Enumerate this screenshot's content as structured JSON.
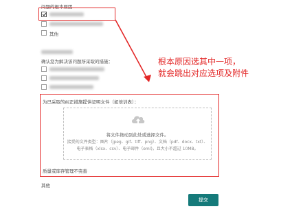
{
  "section1": {
    "title": "问题的根本原因",
    "options": [
      {
        "label": "",
        "checked": true
      },
      {
        "label": "",
        "checked": false
      },
      {
        "label": "其他",
        "checked": false
      }
    ]
  },
  "section2": {
    "title": "确认您为解决该问题所采取的措施："
  },
  "annotation": {
    "line1": "根本原因选其中一项，",
    "line2": "就会跳出对应选项及附件"
  },
  "upload": {
    "title": "为已采取的纠正措施提供证明文件（如培训表）：",
    "icon": "cloud-upload-icon",
    "main_text": "将文件拖动到此处或选择文件。",
    "types_line1": "接受的文件类型：图片（jpeg、gif、tiff、png）、文档（pdf、docx、txt）、",
    "types_line2": "电子表格（xlsx、csv）、电子邮件（eml)，且大小不超过 10MB。"
  },
  "next_item": "质量或库存管理不完善",
  "other_label": "其他",
  "submit_label": "提交",
  "colors": {
    "annotation_red": "#e32727",
    "submit_teal": "#157a7a"
  }
}
